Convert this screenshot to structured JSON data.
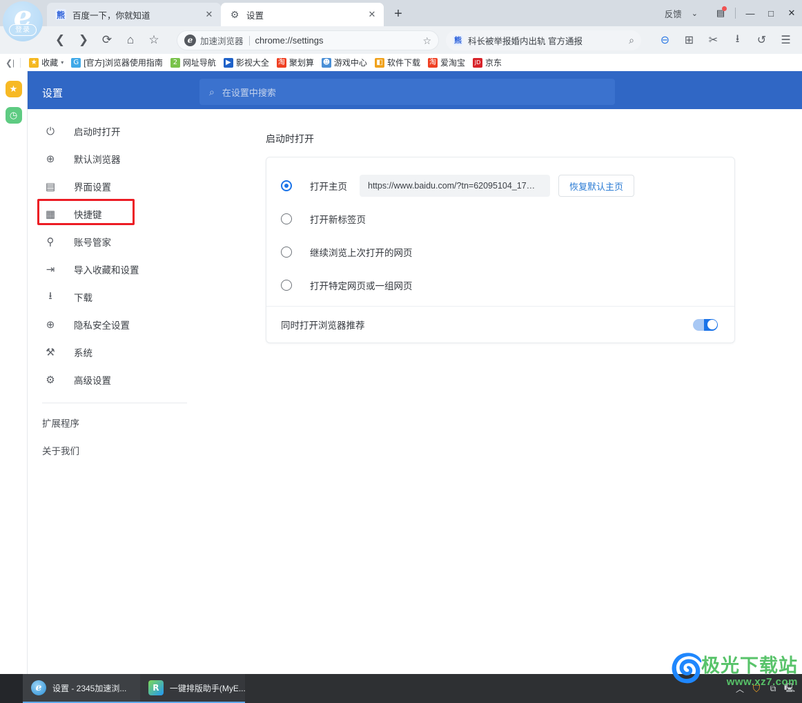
{
  "window": {
    "feedback_label": "反馈",
    "dropdown_icon": "chevron-down-icon",
    "layout_icon": "split-screen-icon",
    "minimize": "—",
    "maximize": "□",
    "close": "✕"
  },
  "brand": {
    "logo_letter": "e",
    "login_label": "登录"
  },
  "tabs": [
    {
      "title": "百度一下，你就知道",
      "favicon": "baidu-icon",
      "favicon_glyph": "熊",
      "active": false,
      "close": "✕"
    },
    {
      "title": "设置",
      "favicon": "gear-icon",
      "favicon_glyph": "⚙",
      "active": true,
      "close": "✕"
    }
  ],
  "newtab_label": "+",
  "nav": {
    "back_icon": "❮",
    "forward_icon": "❯",
    "reload_icon": "⟳",
    "home_icon": "⌂",
    "collect_icon": "☆",
    "omnibox": {
      "brand": "加速浏览器",
      "url": "chrome://settings",
      "star_icon": "☆"
    },
    "searchbox": {
      "favicon_glyph": "熊",
      "query": "科长被举报婚内出轨 官方通报",
      "search_icon": "⌕"
    },
    "tools": [
      {
        "name": "mouse-gesture-icon",
        "glyph": "⊖"
      },
      {
        "name": "apps-grid-icon",
        "glyph": "⊞"
      },
      {
        "name": "screenshot-scissors-icon",
        "glyph": "✂"
      },
      {
        "name": "download-icon",
        "glyph": "⭳"
      },
      {
        "name": "undo-icon",
        "glyph": "↺"
      },
      {
        "name": "menu-icon",
        "glyph": "☰"
      }
    ]
  },
  "bookmarks": {
    "collapse_icon": "❮|",
    "items": [
      {
        "label": "收藏",
        "icon": "star-icon",
        "glyph": "★",
        "color": "#f5b820",
        "caret": "▾"
      },
      {
        "label": "[官方]浏览器使用指南",
        "icon": "guide-icon",
        "glyph": "G",
        "color": "#3fa9e8"
      },
      {
        "label": "网址导航",
        "icon": "nav-2345-icon",
        "glyph": "2",
        "color": "#79c24a"
      },
      {
        "label": "影视大全",
        "icon": "video-icon",
        "glyph": "▶",
        "color": "#1f62c9"
      },
      {
        "label": "聚划算",
        "icon": "juhuasuan-icon",
        "glyph": "淘",
        "color": "#ef4023"
      },
      {
        "label": "游戏中心",
        "icon": "game-icon",
        "glyph": "☻",
        "color": "#4a8fd6"
      },
      {
        "label": "软件下载",
        "icon": "software-icon",
        "glyph": "◧",
        "color": "#f0a21c"
      },
      {
        "label": "爱淘宝",
        "icon": "taobao-icon",
        "glyph": "淘",
        "color": "#ef4023"
      },
      {
        "label": "京东",
        "icon": "jd-icon",
        "glyph": "JD",
        "color": "#d8232a"
      }
    ]
  },
  "rail": [
    {
      "name": "favorites-rail-icon",
      "glyph": "★",
      "color": "#f7b924"
    },
    {
      "name": "history-rail-icon",
      "glyph": "◷",
      "color": "#5ecb82"
    }
  ],
  "settings": {
    "header": {
      "title": "设置",
      "search_placeholder": "在设置中搜索",
      "search_icon": "⌕",
      "bg_color": "#3067c5"
    },
    "sidebar": {
      "items": [
        {
          "label": "启动时打开",
          "icon": "power-icon",
          "glyph": "⏻"
        },
        {
          "label": "默认浏览器",
          "icon": "globe-icon",
          "glyph": "🌐"
        },
        {
          "label": "界面设置",
          "icon": "window-icon",
          "glyph": "▤"
        },
        {
          "label": "快捷键",
          "icon": "keyboard-icon",
          "glyph": "⌨",
          "highlighted": true
        },
        {
          "label": "账号管家",
          "icon": "key-icon",
          "glyph": "⚿"
        },
        {
          "label": "导入收藏和设置",
          "icon": "import-icon",
          "glyph": "⇥"
        },
        {
          "label": "下载",
          "icon": "download-icon",
          "glyph": "⭳"
        },
        {
          "label": "隐私安全设置",
          "icon": "shield-plus-icon",
          "glyph": "⊕"
        },
        {
          "label": "系统",
          "icon": "wrench-icon",
          "glyph": "🔧"
        },
        {
          "label": "高级设置",
          "icon": "gear-icon",
          "glyph": "⚙"
        }
      ],
      "footer": [
        {
          "label": "扩展程序"
        },
        {
          "label": "关于我们"
        }
      ],
      "highlight_color": "#ec1c24"
    },
    "pane": {
      "title": "启动时打开",
      "options": [
        {
          "label": "打开主页",
          "selected": true,
          "url_value": "https://www.baidu.com/?tn=62095104_17…",
          "restore_button": "恢复默认主页"
        },
        {
          "label": "打开新标签页",
          "selected": false
        },
        {
          "label": "继续浏览上次打开的网页",
          "selected": false
        },
        {
          "label": "打开特定网页或一组网页",
          "selected": false
        }
      ],
      "toggle_row": {
        "label": "同时打开浏览器推荐",
        "enabled": true
      },
      "accent_color": "#1a73e8"
    }
  },
  "watermark": {
    "title": "极光下载站",
    "url": "www.xz7.com"
  },
  "taskbar": {
    "items": [
      {
        "label": "设置 - 2345加速浏...",
        "icon": "browser-icon",
        "glyph": "e",
        "active": true
      },
      {
        "label": "一键排版助手(MyE...",
        "icon": "myedit-icon",
        "glyph": "R",
        "active": false
      }
    ],
    "tray": [
      {
        "name": "tray-expand-icon",
        "glyph": "︿"
      },
      {
        "name": "tray-shield-icon",
        "glyph": "🛡"
      },
      {
        "name": "tray-share-icon",
        "glyph": "⧉"
      },
      {
        "name": "tray-network-icon",
        "glyph": "🖧"
      }
    ]
  }
}
